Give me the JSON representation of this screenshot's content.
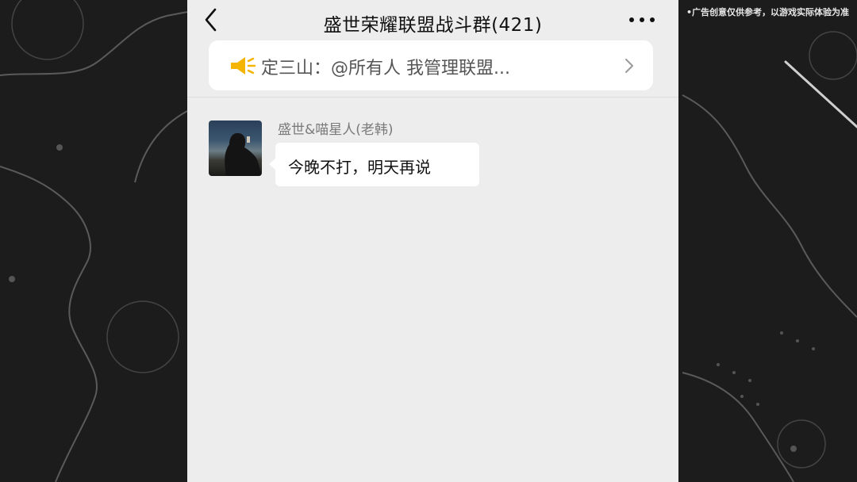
{
  "overlay": {
    "disclaimer": "•广告创意仅供参考，以游戏实际体验为准"
  },
  "nav": {
    "back_icon": "chevron-left-icon",
    "title": "盛世荣耀联盟战斗群(421)",
    "more_icon": "more-dots-icon"
  },
  "notice": {
    "icon": "megaphone-icon",
    "text": "定三山：@所有人 我管理联盟...",
    "arrow_icon": "chevron-right-icon",
    "icon_color": "#f5b400"
  },
  "messages": [
    {
      "sender": "盛世&喵星人(老韩)",
      "text": "今晚不打，明天再说"
    }
  ]
}
